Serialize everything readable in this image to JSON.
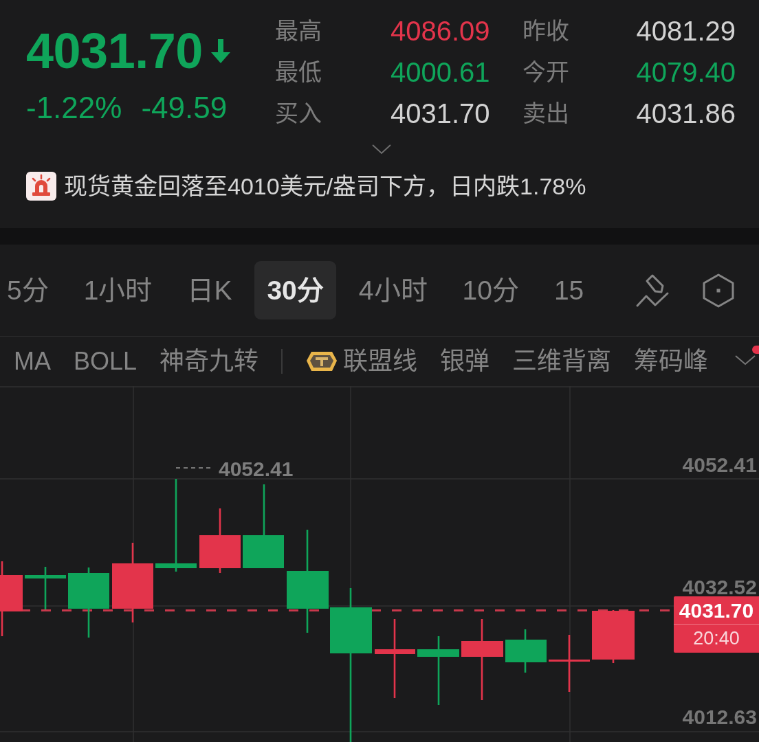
{
  "quote": {
    "price": "4031.70",
    "falling": true,
    "change_percent": "-1.22%",
    "change": "-49.59"
  },
  "stats": [
    {
      "label": "最高",
      "value": "4086.09",
      "color": "#e3344b"
    },
    {
      "label": "昨收",
      "value": "4081.29",
      "color": "#d2d2d2"
    },
    {
      "label": "最低",
      "value": "4000.61",
      "color": "#0fa55a"
    },
    {
      "label": "今开",
      "value": "4079.40",
      "color": "#0fa55a"
    },
    {
      "label": "买入",
      "value": "4031.70",
      "color": "#d2d2d2"
    },
    {
      "label": "卖出",
      "value": "4031.86",
      "color": "#d2d2d2"
    }
  ],
  "news": {
    "text": "现货黄金回落至4010美元/盎司下方，日内跌1.78%"
  },
  "periods": [
    {
      "label": "5分",
      "selected": false
    },
    {
      "label": "1小时",
      "selected": false
    },
    {
      "label": "日K",
      "selected": false
    },
    {
      "label": "30分",
      "selected": true
    },
    {
      "label": "4小时",
      "selected": false
    },
    {
      "label": "10分",
      "selected": false
    },
    {
      "label": "15",
      "selected": false
    }
  ],
  "indicators": [
    {
      "label": "MA",
      "kind": "basic",
      "selected": false
    },
    {
      "label": "BOLL",
      "kind": "basic",
      "selected": false
    },
    {
      "label": "神奇九转",
      "kind": "basic",
      "selected": false
    },
    {
      "label": "联盟线",
      "kind": "premium",
      "selected": false
    },
    {
      "label": "银弹",
      "kind": "basic",
      "selected": false
    },
    {
      "label": "三维背离",
      "kind": "basic",
      "selected": false
    },
    {
      "label": "筹码峰",
      "kind": "basic",
      "selected": false
    }
  ],
  "indicator_menu": {
    "has_new": true
  },
  "chart": {
    "price_axis": [
      "4052.41",
      "4032.52",
      "4012.63"
    ],
    "high_label": "4052.41",
    "last_price": "4031.70",
    "last_time": "20:40"
  }
}
